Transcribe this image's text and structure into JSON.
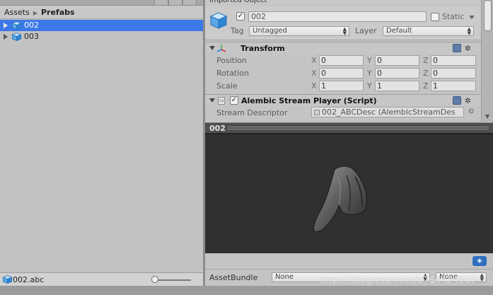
{
  "project": {
    "breadcrumb": [
      "Assets",
      "Prefabs"
    ],
    "items": [
      {
        "name": "002",
        "selected": true
      },
      {
        "name": "003",
        "selected": false
      }
    ],
    "footer_file": "002.abc"
  },
  "inspector": {
    "top_partial_title": "Imported Object",
    "object_name": "002",
    "static_label": "Static",
    "tag_label": "Tag",
    "tag_value": "Untagged",
    "layer_label": "Layer",
    "layer_value": "Default",
    "transform": {
      "title": "Transform",
      "rows": [
        {
          "label": "Position",
          "x": "0",
          "y": "0",
          "z": "0"
        },
        {
          "label": "Rotation",
          "x": "0",
          "y": "0",
          "z": "0"
        },
        {
          "label": "Scale",
          "x": "1",
          "y": "1",
          "z": "1"
        }
      ]
    },
    "script_component": {
      "title": "Alembic Stream Player (Script)",
      "field_label": "Stream Descriptor",
      "field_value": "002_ABCDesc (AlembicStreamDes"
    }
  },
  "preview": {
    "title": "002",
    "assetbundle_label": "AssetBundle",
    "assetbundle_value": "None",
    "variant_value": "None"
  },
  "watermark": "https://blog.csdn.net/u764424567",
  "colors": {
    "selection": "#3c78e8",
    "preview_bg": "#303030",
    "help_icon": "#5e7ea8"
  }
}
